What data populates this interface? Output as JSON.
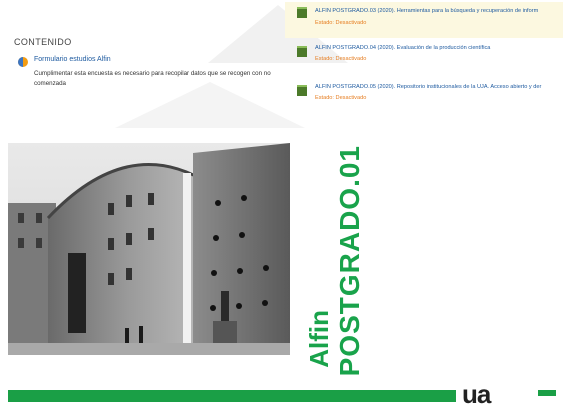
{
  "content": {
    "section_title": "CONTENIDO",
    "activity": {
      "icon": "survey-icon",
      "link_label": "Formulario estudios Alfin",
      "description": "Cumplimentar esta encuesta es necesario para recopilar datos que se recogen con no comenzada"
    }
  },
  "list": {
    "items": [
      {
        "icon": "book-icon",
        "title": "ALFIN POSTGRADO.03 (2020). Herramientas para la búsqueda y recuperación de inform",
        "status": "Estado: Desactivado"
      },
      {
        "icon": "book-icon",
        "title": "ALFIN POSTGRADO.04 (2020). Evaluación de la producción científica",
        "status": "Estado: Desactivado"
      },
      {
        "icon": "book-icon",
        "title": "ALFIN POSTGRADO.05 (2020). Repositorio institucionales de la UJA. Acceso abierto y der",
        "status": "Estado: Desactivado"
      }
    ]
  },
  "banner": {
    "line1": "Alfin",
    "line2": "POSTGRADO.01",
    "bottom_text": "ua",
    "colors": {
      "brand_green": "#1a9f46"
    }
  }
}
